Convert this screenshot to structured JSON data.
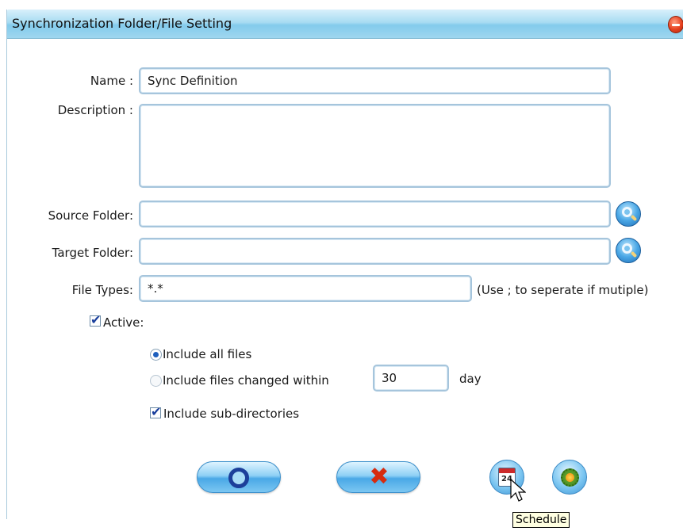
{
  "window": {
    "title": "Synchronization Folder/File Setting"
  },
  "form": {
    "name_label": "Name :",
    "name_value": "Sync Definition",
    "description_label": "Description :",
    "description_value": "",
    "source_label": "Source Folder:",
    "source_value": "",
    "target_label": "Target Folder:",
    "target_value": "",
    "filetypes_label": "File Types:",
    "filetypes_value": "*.*",
    "filetypes_hint": "(Use ; to seperate if mutiple)",
    "active_label": "Active:",
    "active_checked": true,
    "include_all_label": "Include all files",
    "include_changed_label": "Include files changed within",
    "days_value": "30",
    "days_unit": "day",
    "subdirs_label": "Include sub-directories",
    "subdirs_checked": true
  },
  "footer": {
    "tooltip": "Schedule"
  },
  "icons": {
    "browse": "magnifier-icon",
    "ok": "ok-ring-icon",
    "cancel": "red-x-icon",
    "schedule": "calendar-icon",
    "settings": "gear-icon",
    "close": "close-icon"
  },
  "colors": {
    "titlebar": "#9fd6ef",
    "field_border": "#a6c5dc",
    "cancel_x": "#d62c10",
    "close": "#e6401e"
  }
}
